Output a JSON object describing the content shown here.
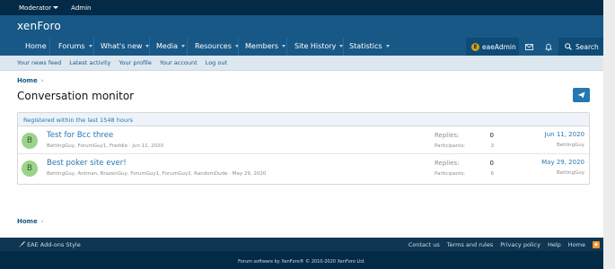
{
  "staff_bar": {
    "moderator": "Moderator",
    "admin": "Admin"
  },
  "logo": "xenForo",
  "nav": {
    "items": [
      "Home",
      "Forums",
      "What's new",
      "Media",
      "Resources",
      "Members",
      "Site History",
      "Statistics"
    ],
    "account": {
      "avatar_letter": "E",
      "name": "eaeAdmin"
    },
    "search_label": "Search"
  },
  "subnav": [
    "Your news feed",
    "Latest activity",
    "Your profile",
    "Your account",
    "Log out"
  ],
  "breadcrumb": "Home",
  "page_title": "Conversation monitor",
  "filter": "Registered within the last 1548 hours",
  "rows": [
    {
      "avatar": "B",
      "title": "Test for Bcc three",
      "participants_list": "BettingGuy, ForumGuy1, Freddie",
      "started": "Jun 11, 2020",
      "replies_label": "Replies:",
      "replies": "0",
      "participants_label": "Participants:",
      "participants": "3",
      "date": "Jun 11, 2020",
      "user": "BettingGuy"
    },
    {
      "avatar": "B",
      "title": "Best poker site ever!",
      "participants_list": "BettingGuy, Antman, BrazenGuy, ForumGuy1, ForumGuy2, RandomDude",
      "started": "May 29, 2020",
      "replies_label": "Replies:",
      "replies": "0",
      "participants_label": "Participants:",
      "participants": "6",
      "date": "May 29, 2020",
      "user": "BettingGuy"
    }
  ],
  "breadcrumb_bottom": "Home",
  "footer": {
    "style": "EAE Add-ons Style",
    "links": [
      "Contact us",
      "Terms and rules",
      "Privacy policy",
      "Help",
      "Home"
    ],
    "copyright": "Forum software by XenForo® © 2010-2020 XenForo Ltd."
  }
}
